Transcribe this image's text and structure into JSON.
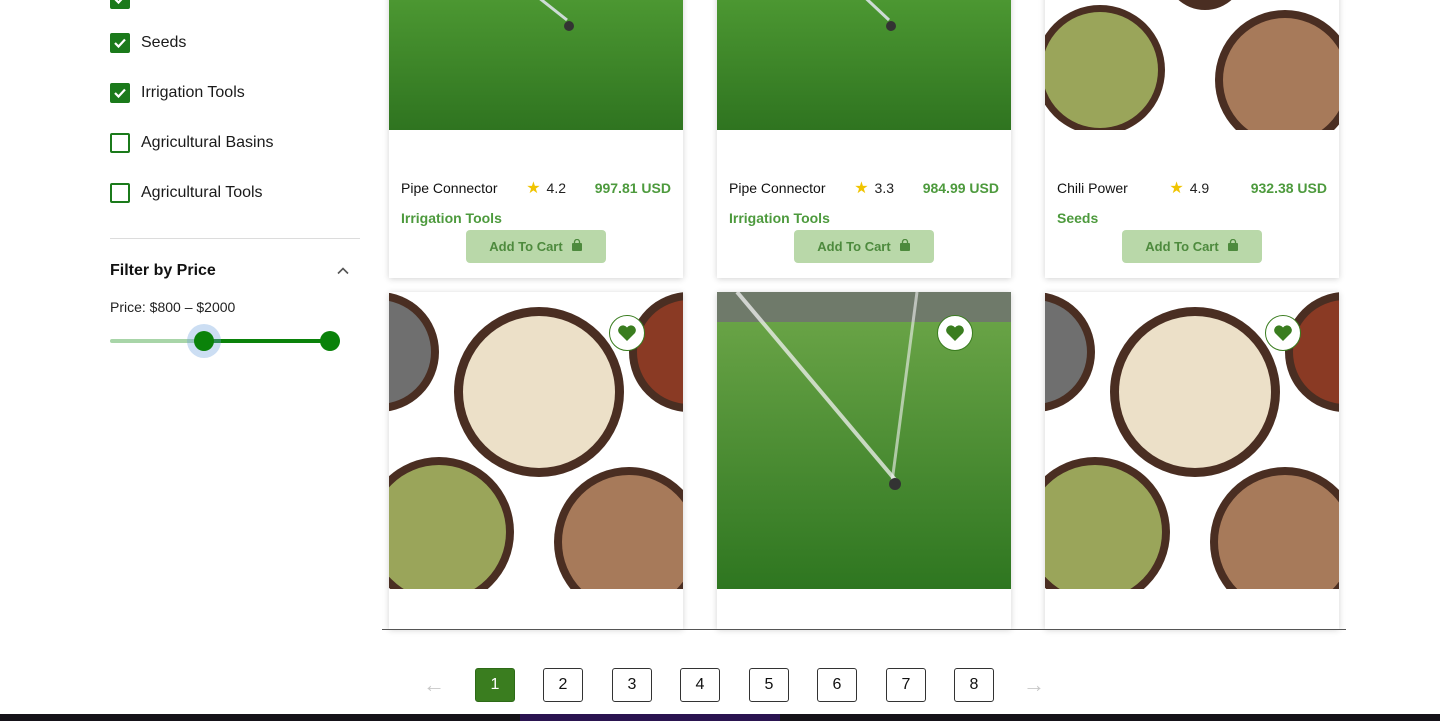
{
  "filters": {
    "categories": [
      {
        "label": "Seeds",
        "checked": true
      },
      {
        "label": "Irrigation Tools",
        "checked": true
      },
      {
        "label": "Agricultural Basins",
        "checked": false
      },
      {
        "label": "Agricultural Tools",
        "checked": false
      }
    ],
    "price_filter": {
      "title": "Filter by Price",
      "price_text": "Price: $800 – $2000",
      "min_value": 800,
      "max_value": 2000,
      "low_fraction": 0.4,
      "high_fraction": 1.0
    }
  },
  "products": [
    {
      "name": "Pipe Connector",
      "rating": "4.2",
      "price": "997.81 USD",
      "category": "Irrigation Tools",
      "cart_label": "Add To Cart",
      "image": "sprinkler"
    },
    {
      "name": "Pipe Connector",
      "rating": "3.3",
      "price": "984.99 USD",
      "category": "Irrigation Tools",
      "cart_label": "Add To Cart",
      "image": "sprinkler"
    },
    {
      "name": "Chili Power",
      "rating": "4.9",
      "price": "932.38 USD",
      "category": "Seeds",
      "cart_label": "Add To Cart",
      "image": "seeds"
    },
    {
      "image": "seeds"
    },
    {
      "image": "sprinkler"
    },
    {
      "image": "seeds"
    }
  ],
  "pagination": {
    "pages": [
      "1",
      "2",
      "3",
      "4",
      "5",
      "6",
      "7",
      "8"
    ],
    "current": "1",
    "prev_icon": "arrow-left-icon",
    "next_icon": "arrow-right-icon"
  },
  "colors": {
    "brand_green": "#3a7d1f",
    "checkbox_green": "#1b7a1b",
    "price_green": "#4d9a3d",
    "slider_green": "#0a820a",
    "cart_button_bg": "#b9d8a9",
    "star_yellow": "#f0c400"
  }
}
